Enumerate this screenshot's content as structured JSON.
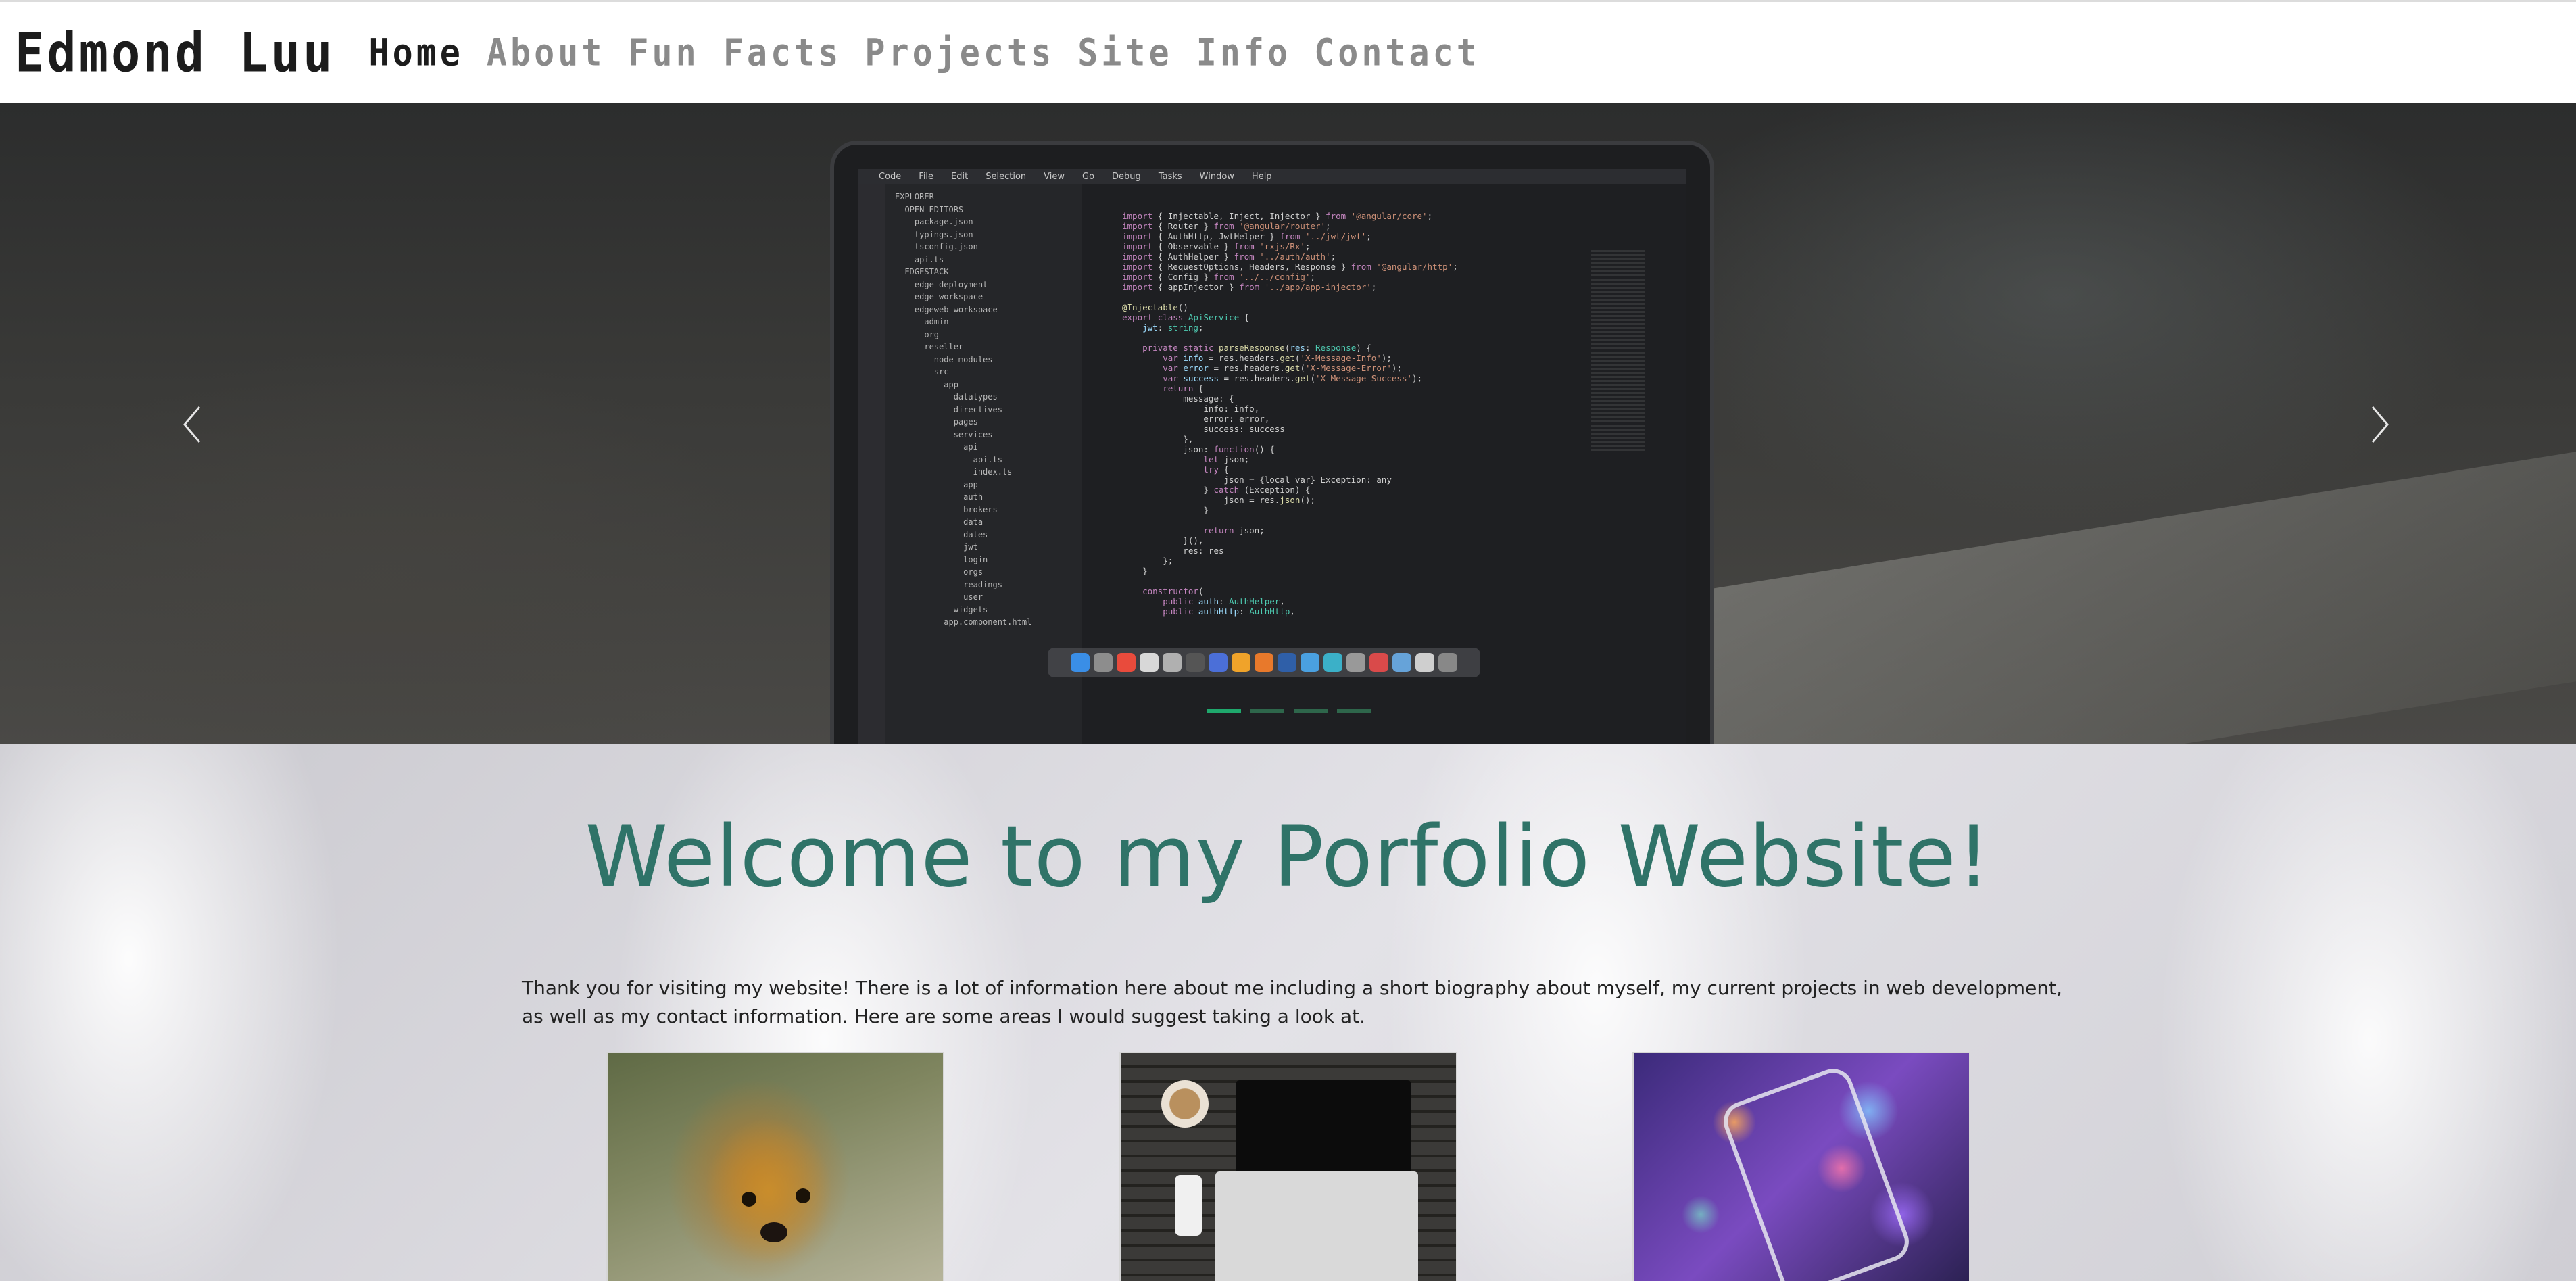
{
  "navbar": {
    "brand": "Edmond Luu",
    "links": [
      {
        "label": "Home",
        "active": true
      },
      {
        "label": "About",
        "active": false
      },
      {
        "label": "Fun Facts",
        "active": false
      },
      {
        "label": "Projects",
        "active": false
      },
      {
        "label": "Site Info",
        "active": false
      },
      {
        "label": "Contact",
        "active": false
      }
    ]
  },
  "carousel": {
    "prev_icon": "chevron-left-icon",
    "next_icon": "chevron-right-icon",
    "slide_count": 4,
    "active_slide": 1,
    "indicator_color": "#1fa86d",
    "laptop_menu": [
      "Code",
      "File",
      "Edit",
      "Selection",
      "View",
      "Go",
      "Debug",
      "Tasks",
      "Window",
      "Help"
    ]
  },
  "welcome": {
    "title": "Welcome to my Porfolio Website!",
    "intro": "Thank you for visiting my website! There is a lot of information here about me including a short biography about myself, my current projects in web development, as well as my contact information. Here are some areas I would suggest taking a look at.",
    "title_color": "#2f7368"
  },
  "cards": [
    {
      "image": "teddy-bear-image"
    },
    {
      "image": "laptop-workspace-image"
    },
    {
      "image": "smartphone-image"
    }
  ]
}
